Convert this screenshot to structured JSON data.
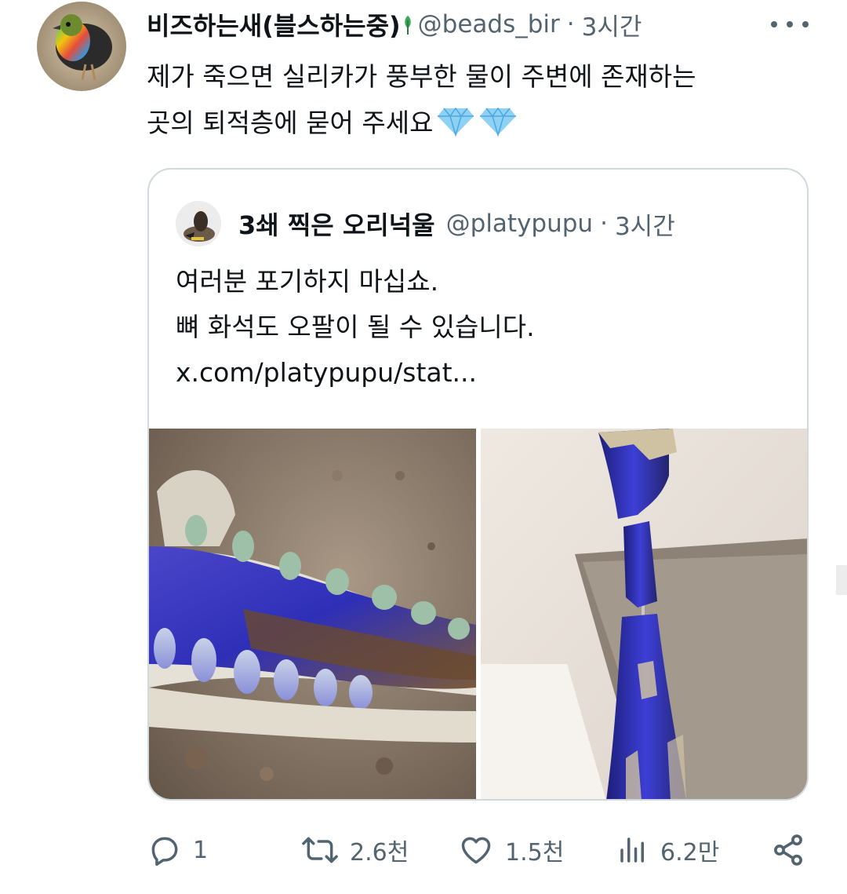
{
  "tweet": {
    "author_name": "비즈하는새(블스하는중)",
    "author_handle": "@beads_bir",
    "time": "3시간",
    "separator": "·",
    "text_lines": [
      "제가 죽으면 실리카가 풍부한 물이 주변에 존재하는",
      "곳의 퇴적층에 묻어 주세요"
    ],
    "trailing_emoji": "gem-stone-emoji"
  },
  "quote": {
    "author_name": "3쇄 찍은 오리넉울",
    "author_handle": "@platypupu",
    "time": "3시간",
    "separator": "·",
    "text_lines": [
      "여러분 포기하지 마십쇼.",
      "뼈 화석도 오팔이 될 수 있습니다.",
      "x.com/platypupu/stat..."
    ]
  },
  "actions": {
    "reply_count": "1",
    "retweet_count": "2.6천",
    "like_count": "1.5천",
    "view_count": "6.2만"
  },
  "icons": {
    "more": "more-horizontal-icon",
    "reply": "reply-icon",
    "retweet": "retweet-icon",
    "like": "heart-icon",
    "views": "bar-chart-icon",
    "share": "share-icon"
  },
  "colors": {
    "text": "#0f1419",
    "secondary": "#536471",
    "border": "#cfd9de",
    "opal_blue": "#3b3fd0"
  }
}
